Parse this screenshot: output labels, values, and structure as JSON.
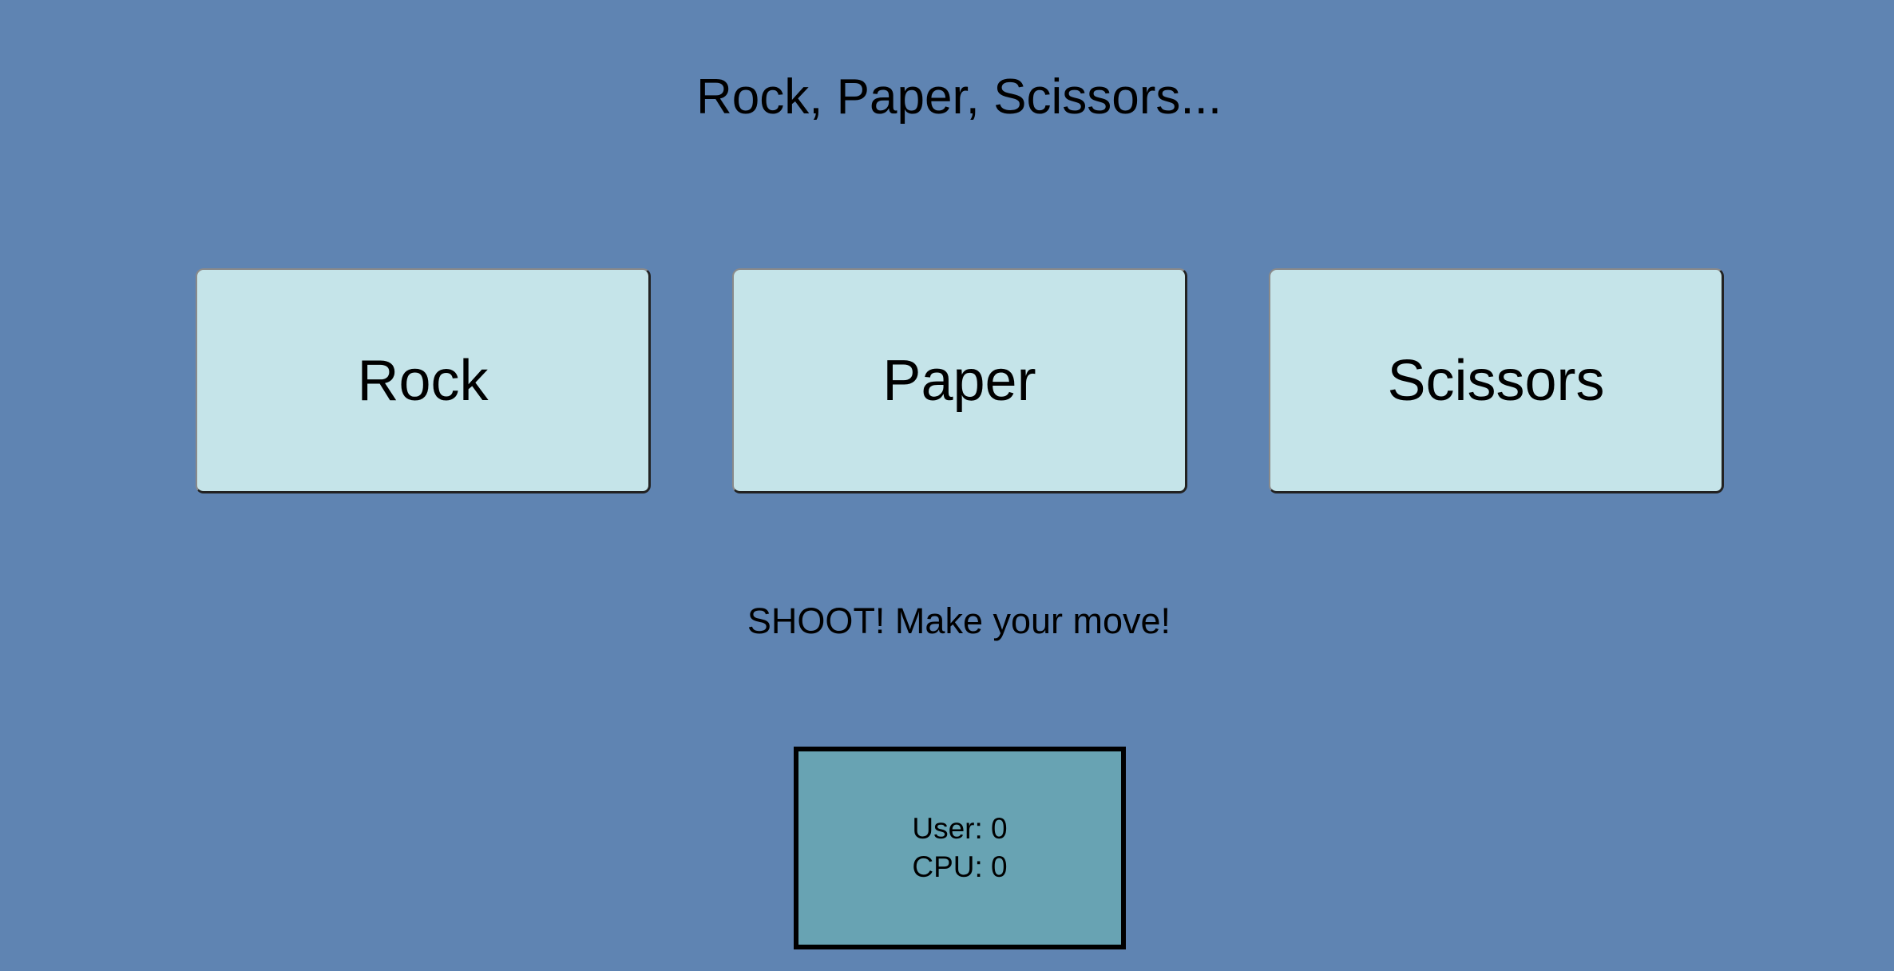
{
  "title": "Rock, Paper, Scissors...",
  "choices": [
    {
      "label": "Rock"
    },
    {
      "label": "Paper"
    },
    {
      "label": "Scissors"
    }
  ],
  "message": "SHOOT! Make your move!",
  "score": {
    "user_label": "User: 0",
    "cpu_label": "CPU: 0",
    "user": 0,
    "cpu": 0
  },
  "colors": {
    "background": "#5f84b2",
    "button": "#c5e4e9",
    "scoreboard": "#68a3b3",
    "text": "#000000"
  }
}
